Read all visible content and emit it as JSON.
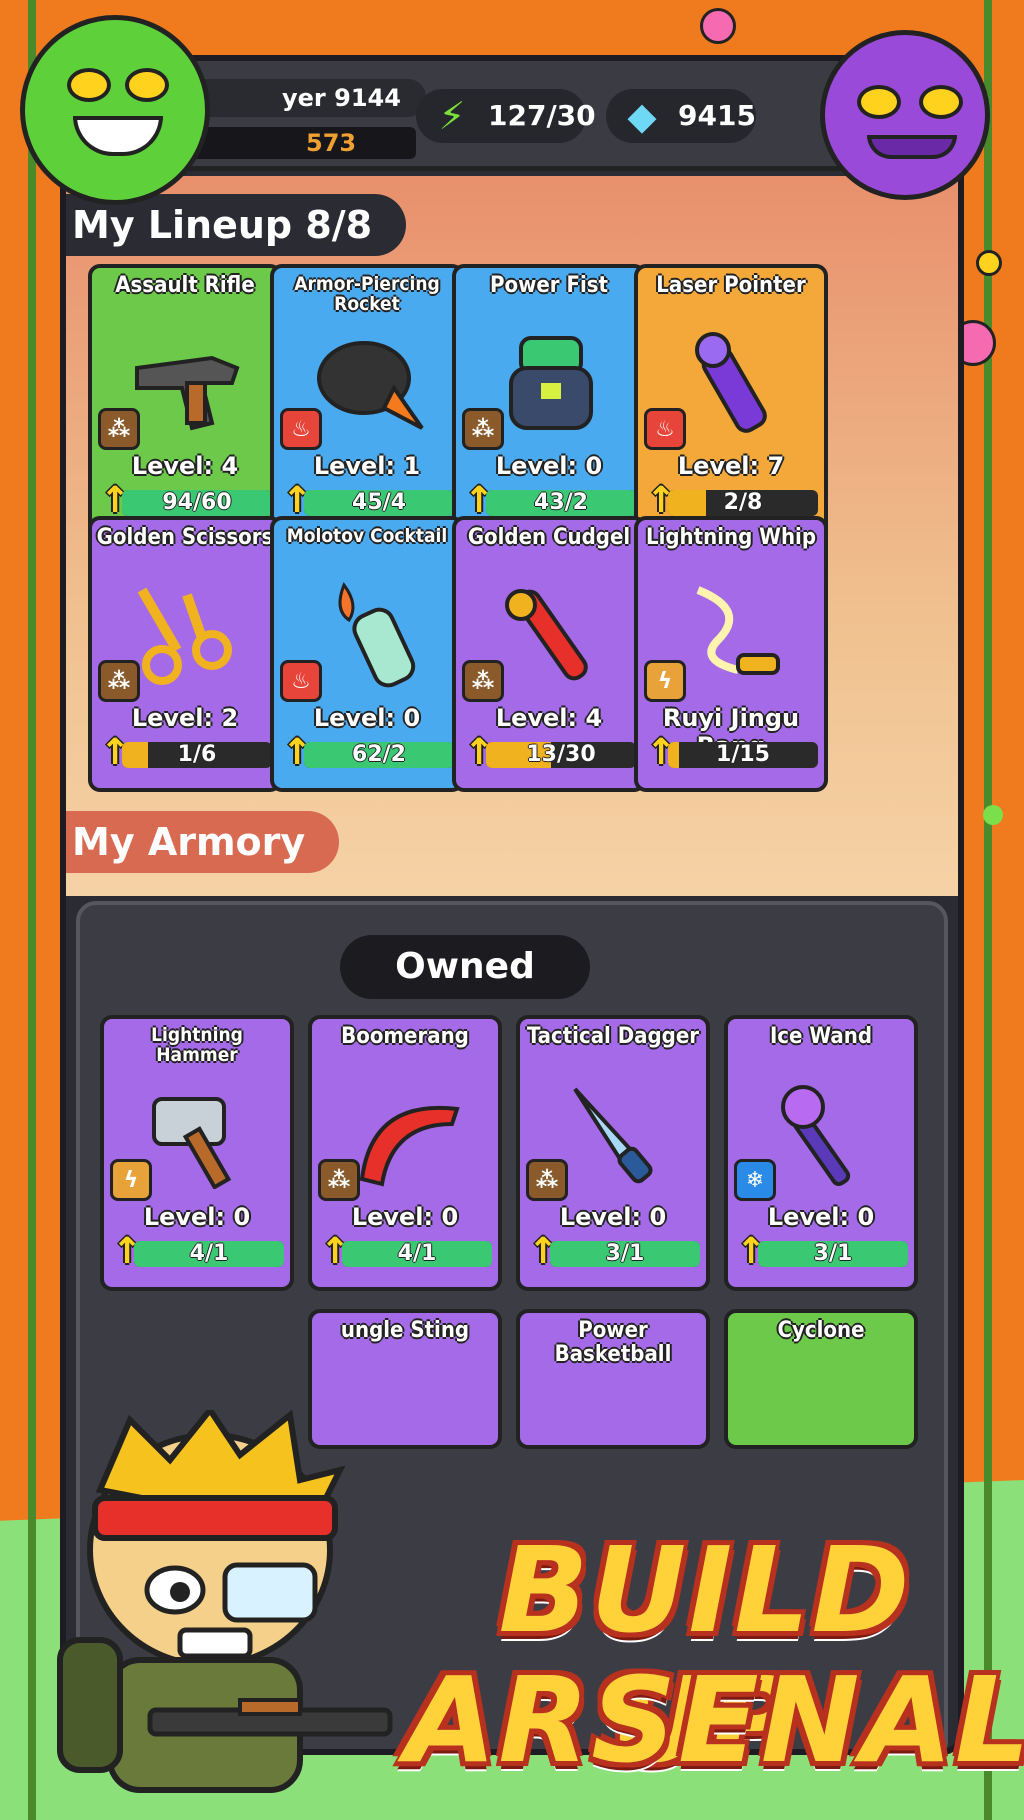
{
  "topbar": {
    "player_name": "yer 9144",
    "player_score": "573",
    "energy": "127/30",
    "gems": "9415"
  },
  "lineup": {
    "title": "My Lineup 8/8",
    "cards": [
      {
        "name": "Assault Rifle",
        "level": "Level: 4",
        "progress": "94/60",
        "fill": 1.0,
        "rarity": "green",
        "element": "claw",
        "icon": "rifle-icon"
      },
      {
        "name": "Armor-Piercing Rocket",
        "level": "Level: 1",
        "progress": "45/4",
        "fill": 1.0,
        "rarity": "blue",
        "element": "fire",
        "icon": "rocket-icon"
      },
      {
        "name": "Power Fist",
        "level": "Level: 0",
        "progress": "43/2",
        "fill": 1.0,
        "rarity": "blue",
        "element": "claw",
        "icon": "fist-icon"
      },
      {
        "name": "Laser Pointer",
        "level": "Level: 7",
        "progress": "2/8",
        "fill": 0.25,
        "rarity": "orange",
        "element": "fire",
        "icon": "laser-icon"
      },
      {
        "name": "Golden Scissors",
        "level": "Level: 2",
        "progress": "1/6",
        "fill": 0.17,
        "rarity": "purple",
        "element": "claw",
        "icon": "scissors-icon"
      },
      {
        "name": "Molotov Cocktail",
        "level": "Level: 0",
        "progress": "62/2",
        "fill": 1.0,
        "rarity": "blue",
        "element": "fire",
        "icon": "bottle-icon"
      },
      {
        "name": "Golden Cudgel",
        "level": "Level: 4",
        "progress": "13/30",
        "fill": 0.43,
        "rarity": "purple",
        "element": "claw",
        "icon": "cudgel-icon"
      },
      {
        "name": "Lightning Whip",
        "level": "Ruyi Jingu Bang",
        "progress": "1/15",
        "fill": 0.07,
        "rarity": "purple",
        "element": "bolt",
        "icon": "whip-icon"
      }
    ]
  },
  "armory": {
    "title": "My Armory",
    "filter": "Owned",
    "cards": [
      {
        "name": "Lightning Hammer",
        "level": "Level: 0",
        "progress": "4/1",
        "fill": 1.0,
        "rarity": "purple",
        "element": "bolt",
        "icon": "hammer-icon"
      },
      {
        "name": "Boomerang",
        "level": "Level: 0",
        "progress": "4/1",
        "fill": 1.0,
        "rarity": "purple",
        "element": "claw",
        "icon": "boomerang-icon"
      },
      {
        "name": "Tactical Dagger",
        "level": "Level: 0",
        "progress": "3/1",
        "fill": 1.0,
        "rarity": "purple",
        "element": "claw",
        "icon": "dagger-icon"
      },
      {
        "name": "Ice Wand",
        "level": "Level: 0",
        "progress": "3/1",
        "fill": 1.0,
        "rarity": "purple",
        "element": "frost",
        "icon": "wand-icon"
      }
    ],
    "partial_cards": [
      "ungle Sting",
      "Power Basketball",
      "Cyclone"
    ]
  },
  "banner": {
    "line1": "BUILD UP",
    "line2": "ARSENAL"
  },
  "colors": {
    "background": "#f07a1e",
    "green_rarity": "#6cc94a",
    "blue_rarity": "#4aaaf0",
    "purple_rarity": "#a56ae8",
    "orange_rarity": "#f5a83a",
    "progress_green": "#3ac873",
    "progress_yellow": "#f0b21e"
  }
}
